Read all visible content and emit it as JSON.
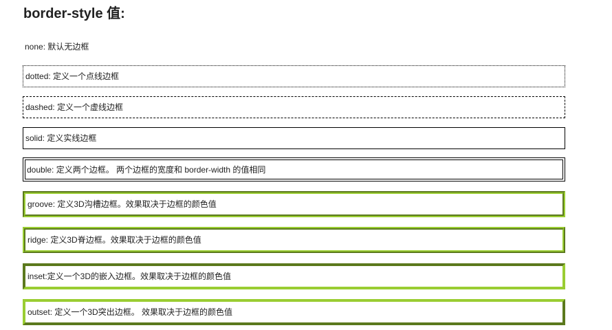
{
  "heading": "border-style 值:",
  "items": [
    {
      "text": "none: 默认无边框"
    },
    {
      "text": "dotted: 定义一个点线边框"
    },
    {
      "text": "dashed: 定义一个虚线边框"
    },
    {
      "text": "solid: 定义实线边框"
    },
    {
      "text": "double: 定义两个边框。 两个边框的宽度和 border-width 的值相同"
    },
    {
      "text": "groove: 定义3D沟槽边框。效果取决于边框的颜色值"
    },
    {
      "text": "ridge: 定义3D脊边框。效果取决于边框的颜色值"
    },
    {
      "text": "inset:定义一个3D的嵌入边框。效果取决于边框的颜色值"
    },
    {
      "text": "outset: 定义一个3D突出边框。 效果取决于边框的颜色值"
    }
  ],
  "colors": {
    "border_plain": "#000000",
    "border_3d": "#9acd32",
    "text": "#222222"
  }
}
